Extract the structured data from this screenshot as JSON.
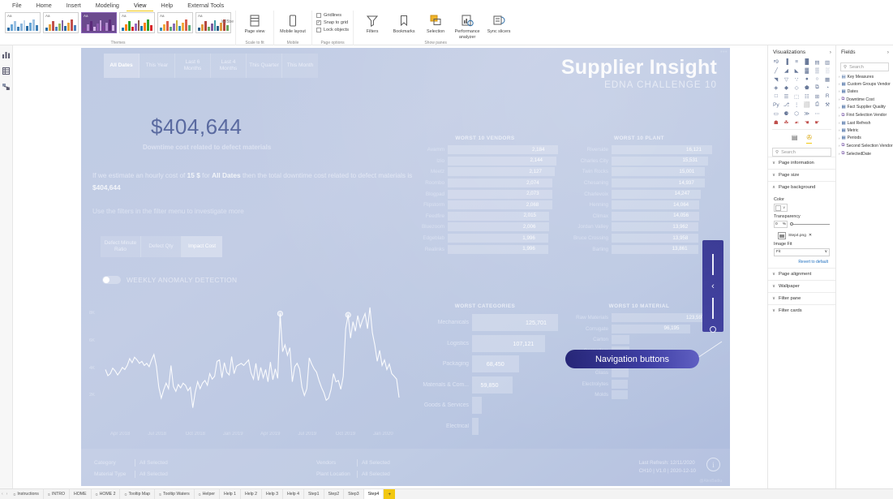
{
  "ribbon": {
    "menu": [
      {
        "label": "File",
        "active": false
      },
      {
        "label": "Home",
        "active": false
      },
      {
        "label": "Insert",
        "active": false
      },
      {
        "label": "Modeling",
        "active": false
      },
      {
        "label": "View",
        "active": true
      },
      {
        "label": "Help",
        "active": false
      },
      {
        "label": "External Tools",
        "active": false
      }
    ],
    "groups": {
      "themes": {
        "label": "Themes",
        "aa": "Aa",
        "selected_index": 2
      },
      "scale_to_fit": {
        "label": "Scale to fit",
        "button": "Page view",
        "caret": "▾"
      },
      "mobile": {
        "label": "Mobile",
        "button": "Mobile layout"
      },
      "page_options": {
        "label": "Page options",
        "items": [
          {
            "label": "Gridlines",
            "checked": false
          },
          {
            "label": "Snap to grid",
            "checked": true
          },
          {
            "label": "Lock objects",
            "checked": false
          }
        ]
      },
      "show_panes": {
        "label": "Show panes",
        "items": [
          "Filters",
          "Bookmarks",
          "Selection",
          "Performance analyzer",
          "Sync slicers"
        ]
      }
    }
  },
  "left_rail": [
    {
      "icon": "report-icon",
      "glyph": "ᵜ9"
    },
    {
      "icon": "data-table-icon",
      "glyph": "⌗"
    },
    {
      "icon": "model-icon",
      "glyph": "⧉"
    }
  ],
  "report": {
    "title": "Supplier Insight",
    "subtitle": "EDNA CHALLENGE 10",
    "more_dots": "•••",
    "date_slicer": [
      {
        "label": "All Dates",
        "selected": true
      },
      {
        "label": "This Year",
        "selected": false
      },
      {
        "label": "Last 6 Months",
        "selected": false
      },
      {
        "label": "Last 4 Months",
        "selected": false
      },
      {
        "label": "This Quarter",
        "selected": false
      },
      {
        "label": "This Month",
        "selected": false
      }
    ],
    "kpi_value": "$404,644",
    "kpi_subtitle": "Downtime cost related to defect materials",
    "narrative_pre": "If we estimate an hourly cost of ",
    "narrative_rate": "15 $",
    "narrative_mid": " for ",
    "narrative_period": "All Dates",
    "narrative_post": " then the total downtime cost related to defect materials is ",
    "narrative_total": "$404,644",
    "narrative_hint": "Use the filters in the filter menu to investigate more",
    "measure_buttons": [
      {
        "label": "Defect Minute Ratio",
        "selected": false
      },
      {
        "label": "Defect Qty",
        "selected": false
      },
      {
        "label": "Impact Cost",
        "selected": true
      }
    ],
    "toggle": {
      "label": "WEEKLY ANOMALY DETECTION",
      "on": false
    },
    "callout": {
      "label": "Navigation buttons"
    },
    "nav_panel": {
      "chevron": "‹"
    },
    "footer": {
      "filters": [
        {
          "key": "Category",
          "value": "All Selected"
        },
        {
          "key": "Material Type",
          "value": "All Selected"
        },
        {
          "key": "Vendors",
          "value": "All Selected"
        },
        {
          "key": "Plant Location",
          "value": "All Selected"
        }
      ],
      "refresh_line1": "Last Refresh: 12/11/2020",
      "refresh_line2": "CH10 | V1.0 | 2020-12-10",
      "info_glyph": "i",
      "author": "@AlexBadiu"
    }
  },
  "chart_data": [
    {
      "type": "line",
      "title": "",
      "xlabel": "",
      "ylabel": "",
      "ylim": [
        0,
        8800
      ],
      "yticks": [
        "2K",
        "4K",
        "6K",
        "8K"
      ],
      "ytick_values": [
        2000,
        4000,
        6000,
        8000
      ],
      "xticks": [
        "Apr 2018",
        "Jul 2018",
        "Oct 2018",
        "Jan 2019",
        "Apr 2019",
        "Jul 2019",
        "Oct 2019",
        "Jan 2020"
      ],
      "grid": false,
      "legend": "none",
      "values": [
        3900,
        3450,
        3600,
        4000,
        3800,
        3500,
        3750,
        4050,
        3900,
        4200,
        4700,
        4400,
        4800,
        4600,
        4350,
        4500,
        4200,
        4350,
        4100,
        4600,
        5000,
        4150,
        2600,
        1800,
        2400,
        2900,
        2500,
        4200,
        2650,
        2300,
        2800,
        2550,
        2900,
        2750,
        2350,
        2600,
        1100,
        2250,
        3000,
        2500,
        2900,
        3100,
        2750,
        3600,
        3200,
        3400,
        4500,
        4600,
        3300,
        4400,
        3700,
        3500,
        4850,
        3600,
        4150,
        4250,
        4350,
        4200,
        4400,
        4600,
        3650,
        3200,
        4350,
        3100,
        4050,
        3300,
        3900,
        3000,
        4450,
        3150,
        3950,
        3250,
        8000,
        5200,
        5700,
        4950,
        5500,
        3000,
        4100,
        4350,
        3950,
        2600,
        2000,
        2500,
        4750,
        4300,
        3950,
        3700,
        3100,
        2600,
        2200,
        1650,
        1800,
        2450,
        3600,
        3000,
        3100,
        2450,
        3400,
        6900,
        7900,
        6200,
        7400,
        6700,
        7850,
        7000,
        7550,
        8000,
        6900,
        8450,
        6600,
        5700,
        4500,
        5300,
        4200,
        4600,
        3900,
        4300,
        3600,
        3400,
        3200,
        1850
      ],
      "anomalies": [
        {
          "x_index": 72,
          "value": 8000
        },
        {
          "x_index": 100,
          "value": 7900
        }
      ]
    },
    {
      "type": "bar",
      "orientation": "horizontal",
      "title": "WORST 10 VENDORS",
      "categories": [
        "Avamm",
        "Izio",
        "Meetz",
        "Roombo",
        "Blogpad",
        "Flipstorm",
        "Feedfire",
        "Bluezoom",
        "Edgeblab",
        "Realinks"
      ],
      "values": [
        2184,
        2144,
        2127,
        2074,
        2073,
        2068,
        2015,
        2006,
        1996,
        1996
      ],
      "value_labels": [
        "2,184",
        "2,144",
        "2,127",
        "2,074",
        "2,073",
        "2,068",
        "2,015",
        "2,006",
        "1,996",
        "1,996"
      ],
      "xlabel": "",
      "ylabel": ""
    },
    {
      "type": "bar",
      "orientation": "horizontal",
      "title": "WORST 10 PLANT",
      "categories": [
        "Riverside",
        "Charles City",
        "Twin Rocks",
        "Chesaning",
        "Charlevoix",
        "Henning",
        "Climax",
        "Jordan Valley",
        "Bruce Crossing",
        "Barling"
      ],
      "values": [
        16121,
        15531,
        15001,
        14937,
        14247,
        14064,
        14056,
        13962,
        13958,
        13861
      ],
      "value_labels": [
        "16,121",
        "15,531",
        "15,001",
        "14,937",
        "14,247",
        "14,064",
        "14,056",
        "13,962",
        "13,958",
        "13,861"
      ],
      "xlabel": "",
      "ylabel": ""
    },
    {
      "type": "bar",
      "orientation": "horizontal",
      "title": "WORST CATEGORIES",
      "categories": [
        "Mechanicals",
        "Logistics",
        "Packaging",
        "Materials & Com...",
        "Goods & Services",
        "Electrical"
      ],
      "values": [
        125701,
        107121,
        68450,
        59850,
        14000,
        5500
      ],
      "value_labels": [
        "125,701",
        "107,121",
        "68,450",
        "59,850",
        "",
        ""
      ],
      "xlabel": "",
      "ylabel": ""
    },
    {
      "type": "bar",
      "orientation": "horizontal",
      "title": "WORST 10 MATERIAL",
      "categories": [
        "Raw Materials",
        "Corrugate",
        "Carton",
        "Controllers",
        "Batteries",
        "Glass",
        "Electrolytes",
        "Molds"
      ],
      "values": [
        123597,
        96195,
        22000,
        21500,
        21000,
        20500,
        20000,
        19500
      ],
      "value_labels": [
        "123,597",
        "96,195",
        "",
        "",
        "",
        "",
        "",
        ""
      ],
      "xlabel": "",
      "ylabel": ""
    }
  ],
  "visualizations_pane": {
    "title": "Visualizations",
    "collapse_glyph": "›",
    "icons": [
      "stacked-bar-chart-icon",
      "stacked-column-chart-icon",
      "clustered-bar-chart-icon",
      "clustered-column-chart-icon",
      "100-stacked-bar-icon",
      "100-stacked-column-icon",
      "line-chart-icon",
      "area-chart-icon",
      "stacked-area-chart-icon",
      "line-stacked-column-icon",
      "line-clustered-column-icon",
      "ribbon-chart-icon",
      "waterfall-chart-icon",
      "funnel-chart-icon",
      "scatter-chart-icon",
      "pie-chart-icon",
      "donut-chart-icon",
      "treemap-icon",
      "map-icon",
      "filled-map-icon",
      "shape-map-icon",
      "azure-map-icon",
      "arcgis-map-icon",
      "gauge-icon",
      "card-icon",
      "multi-row-card-icon",
      "kpi-icon",
      "slicer-icon",
      "table-icon",
      "r-script-visual-icon",
      "python-visual-icon",
      "key-influencers-icon",
      "decomposition-tree-icon",
      "qa-visual-icon",
      "paginated-report-icon",
      "smart-narrative-icon",
      "blank-visual-icon",
      "metrics-icon",
      "power-apps-icon",
      "power-automate-icon",
      "more-options-icon"
    ],
    "custom_icons": [
      "delete-visual-icon",
      "add-visual-icon",
      "edit-visual-icon",
      "filter-visual-icon",
      "sync-visual-icon"
    ],
    "tabs": [
      {
        "name": "fields-tab",
        "glyph": "▤",
        "active": false
      },
      {
        "name": "format-tab",
        "glyph": "✇",
        "active": true
      }
    ],
    "search_placeholder": "Search",
    "sections": [
      {
        "label": "Page information",
        "expanded": false,
        "chevron": "∨"
      },
      {
        "label": "Page size",
        "expanded": false,
        "chevron": "∨"
      },
      {
        "label": "Page background",
        "expanded": true,
        "chevron": "∧"
      },
      {
        "label": "Page alignment",
        "expanded": false,
        "chevron": "∨"
      },
      {
        "label": "Wallpaper",
        "expanded": false,
        "chevron": "∨"
      },
      {
        "label": "Filter pane",
        "expanded": false,
        "chevron": "∨"
      },
      {
        "label": "Filter cards",
        "expanded": false,
        "chevron": "∨"
      }
    ],
    "page_background": {
      "color_label": "Color",
      "color_value": "#FFFFFF",
      "color_caret": "∨",
      "transparency_label": "Transparency",
      "transparency_value": "0",
      "transparency_unit": "%",
      "image_name": "Step4.png",
      "image_remove": "✕",
      "image_fit_label": "Image Fit",
      "image_fit_value": "Fit",
      "image_fit_caret": "∨",
      "revert_label": "Revert to default"
    }
  },
  "fields_pane": {
    "title": "Fields",
    "collapse_glyph": "›",
    "search_placeholder": "Search",
    "items": [
      {
        "label": "Key Measures",
        "icon": "folder-measure-icon",
        "chevron": "›"
      },
      {
        "label": "Custom Groups Vendor",
        "icon": "table-icon",
        "chevron": "›"
      },
      {
        "label": "Dates",
        "icon": "table-icon",
        "chevron": "›"
      },
      {
        "label": "Downtime Cost",
        "icon": "linked-table-icon",
        "chevron": "›"
      },
      {
        "label": "Fact Supplier Quality",
        "icon": "table-icon",
        "chevron": "›"
      },
      {
        "label": "First Selection Vendor",
        "icon": "linked-table-icon",
        "chevron": "›"
      },
      {
        "label": "Last Refresh",
        "icon": "table-icon",
        "chevron": "›"
      },
      {
        "label": "Metric",
        "icon": "table-icon",
        "chevron": "›"
      },
      {
        "label": "Periods",
        "icon": "table-icon",
        "chevron": "›"
      },
      {
        "label": "Second Selection Vendor",
        "icon": "linked-table-icon",
        "chevron": "›"
      },
      {
        "label": "SelectedDate",
        "icon": "linked-table-icon",
        "chevron": "›"
      }
    ]
  },
  "page_tabs": {
    "prev_glyph": "‹",
    "next_glyph": "›",
    "tabs": [
      {
        "label": "Instructions",
        "hidden": true,
        "active": false
      },
      {
        "label": "INTRO",
        "hidden": true,
        "active": false
      },
      {
        "label": "HOME",
        "hidden": false,
        "active": false
      },
      {
        "label": "HOME 2",
        "hidden": true,
        "active": false
      },
      {
        "label": "Tooltip Map",
        "hidden": true,
        "active": false
      },
      {
        "label": "Tooltip Waters",
        "hidden": true,
        "active": false
      },
      {
        "label": "Helper",
        "hidden": true,
        "active": false
      },
      {
        "label": "Help 1",
        "hidden": false,
        "active": false
      },
      {
        "label": "Help 2",
        "hidden": false,
        "active": false
      },
      {
        "label": "Help 3",
        "hidden": false,
        "active": false
      },
      {
        "label": "Help 4",
        "hidden": false,
        "active": false
      },
      {
        "label": "Step1",
        "hidden": false,
        "active": false
      },
      {
        "label": "Step2",
        "hidden": false,
        "active": false
      },
      {
        "label": "Step3",
        "hidden": false,
        "active": false
      },
      {
        "label": "Step4",
        "hidden": false,
        "active": true
      }
    ],
    "add_label": "+"
  },
  "colors": {
    "accent_yellow": "#F2C811",
    "canvas_blue": "#BFCBE4",
    "callout_navy": "#2F2F8F",
    "kpi_text": "#5A6AA0"
  }
}
